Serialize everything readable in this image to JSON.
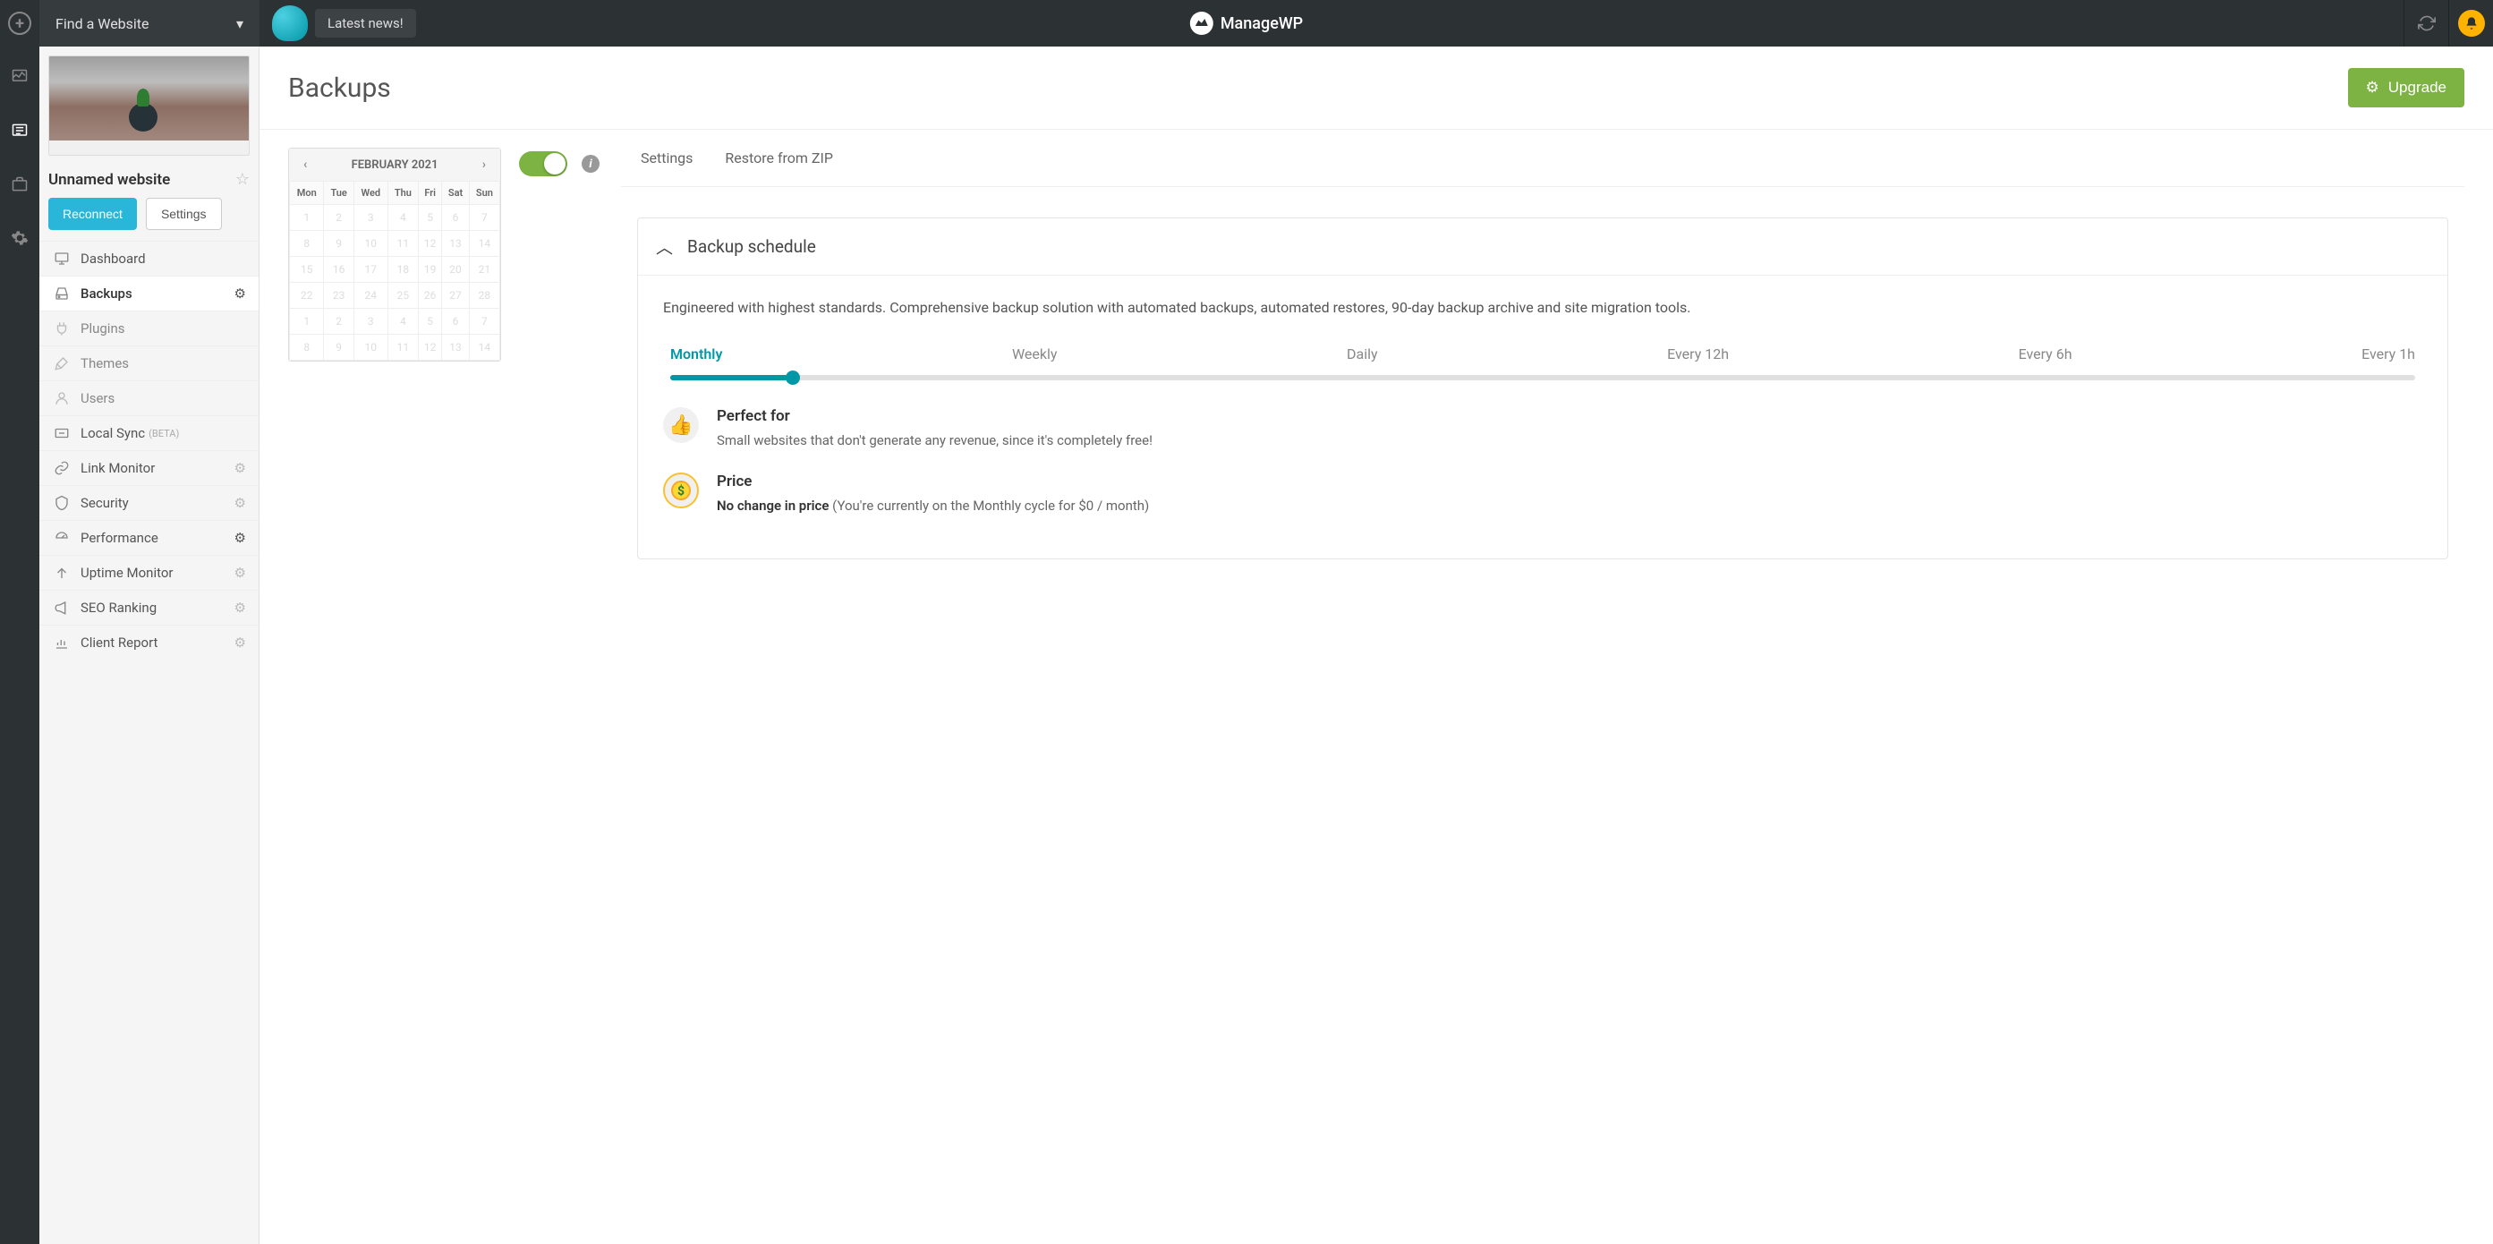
{
  "topbar": {
    "search_placeholder": "Find a Website",
    "news_label": "Latest news!",
    "logo_text": "ManageWP"
  },
  "sidebar": {
    "site_name": "Unnamed website",
    "reconnect_label": "Reconnect",
    "settings_label": "Settings",
    "menu": {
      "dashboard": "Dashboard",
      "backups": "Backups",
      "plugins": "Plugins",
      "themes": "Themes",
      "users": "Users",
      "local_sync": "Local Sync",
      "local_sync_beta": "(BETA)",
      "link_monitor": "Link Monitor",
      "security": "Security",
      "performance": "Performance",
      "uptime_monitor": "Uptime Monitor",
      "seo_ranking": "SEO Ranking",
      "client_report": "Client Report"
    }
  },
  "main": {
    "title": "Backups",
    "upgrade_label": "Upgrade",
    "tabs": {
      "settings": "Settings",
      "restore_zip": "Restore from ZIP"
    }
  },
  "calendar": {
    "month_label": "FEBRUARY 2021",
    "days": [
      "Mon",
      "Tue",
      "Wed",
      "Thu",
      "Fri",
      "Sat",
      "Sun"
    ],
    "rows": [
      [
        "1",
        "2",
        "3",
        "4",
        "5",
        "6",
        "7"
      ],
      [
        "8",
        "9",
        "10",
        "11",
        "12",
        "13",
        "14"
      ],
      [
        "15",
        "16",
        "17",
        "18",
        "19",
        "20",
        "21"
      ],
      [
        "22",
        "23",
        "24",
        "25",
        "26",
        "27",
        "28"
      ],
      [
        "1",
        "2",
        "3",
        "4",
        "5",
        "6",
        "7"
      ],
      [
        "8",
        "9",
        "10",
        "11",
        "12",
        "13",
        "14"
      ]
    ]
  },
  "schedule": {
    "title": "Backup schedule",
    "description": "Engineered with highest standards. Comprehensive backup solution with automated backups, automated restores, 90-day backup archive and site migration tools.",
    "frequencies": [
      "Monthly",
      "Weekly",
      "Daily",
      "Every 12h",
      "Every 6h",
      "Every 1h"
    ],
    "selected_frequency": "Monthly",
    "perfect_for_title": "Perfect for",
    "perfect_for_text": "Small websites that don't generate any revenue, since it's completely free!",
    "price_title": "Price",
    "price_bold": "No change in price",
    "price_rest": " (You're currently on the Monthly cycle for $0 / month)"
  }
}
